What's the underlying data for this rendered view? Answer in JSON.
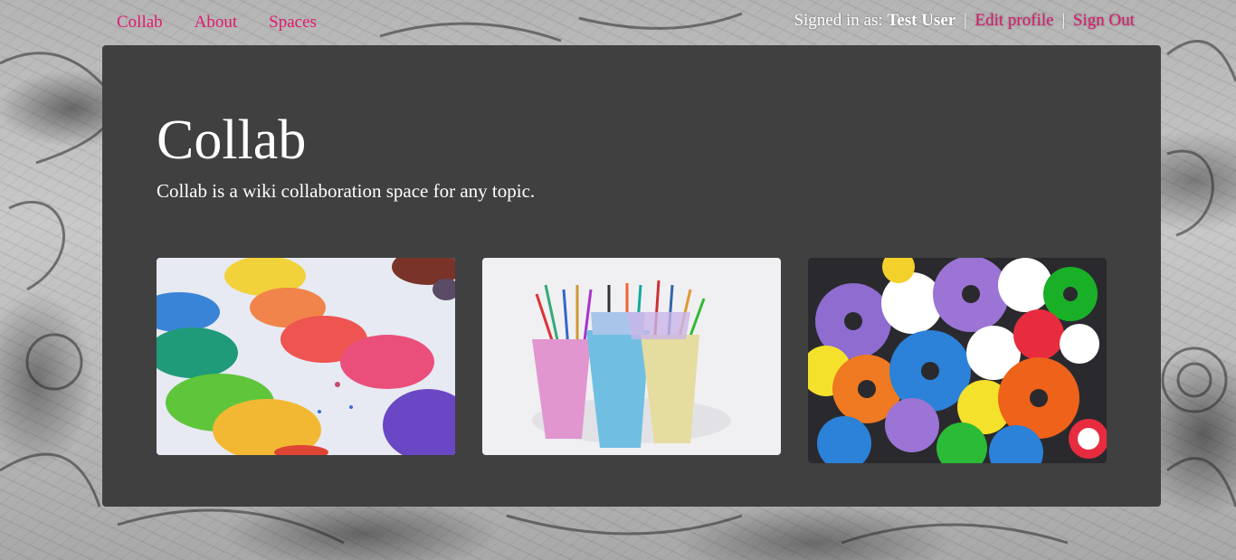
{
  "nav": {
    "links": [
      {
        "label": "Collab"
      },
      {
        "label": "About"
      },
      {
        "label": "Spaces"
      }
    ],
    "user": {
      "prefix": "Signed in as:",
      "name": "Test User",
      "separator": "|",
      "edit_profile": "Edit profile",
      "sign_out": "Sign Out"
    },
    "link_color": "#e0196e"
  },
  "hero": {
    "title": "Collab",
    "subtitle": "Collab is a wiki collaboration space for any topic."
  },
  "cards": [
    {
      "image": "watercolor-palette-photo"
    },
    {
      "image": "colored-pencils-cups-photo"
    },
    {
      "image": "colorful-gears-photo"
    }
  ],
  "colors": {
    "panel": "#404040",
    "text": "#ffffff"
  }
}
